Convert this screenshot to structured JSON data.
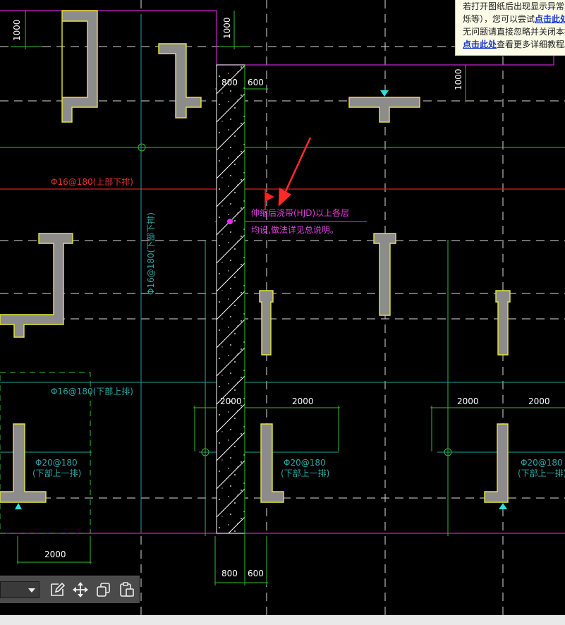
{
  "notice": {
    "line1": "若打开图纸后出现显示异常(",
    "line2_a": "烁等），您可以尝试",
    "line2_link": "点击此处",
    "line3": "无问题请直接忽略并关闭本提",
    "line4_link": "点击此处",
    "line4_b": "查看更多详细教程。"
  },
  "drawing": {
    "dim_1000_left": "1000",
    "dim_1000_top": "1000",
    "dim_1000_right": "1000",
    "dim_800_top": "800",
    "dim_600_top": "600",
    "dim_800_bottom": "800",
    "dim_600_bottom": "600",
    "rebar_red": "Φ16@180(上部下排)",
    "rebar_vertical": "Φ16@180(下部下排)",
    "rebar_cyan_mid": "Φ16@180(下部上排)",
    "rebar_left_1": "Φ20@180",
    "rebar_left_2": "(下部上一排)",
    "rebar_center_1": "Φ20@180",
    "rebar_center_2": "(下部上一排)",
    "rebar_right_1": "Φ20@180",
    "rebar_right_2": "(下部上一排)",
    "note_line1": "伸缩后浇带(HJD)以上各层",
    "note_line2": "均设,做法详见总说明。",
    "dim_2000_a": "2000",
    "dim_2000_b": "2000",
    "dim_2000_c": "2000",
    "dim_2000_d": "2000",
    "dim_2000_bottom": "2000"
  },
  "toolbar": {
    "icons": [
      "edit-icon",
      "move-icon",
      "copy-icon",
      "paste-icon"
    ]
  },
  "colors": {
    "background": "#000000",
    "column_fill": "#8a8a8a",
    "column_outline": "#e6e632",
    "axis_line": "#ffffff",
    "green_line": "#2fc82f",
    "red_line": "#e02020",
    "magenta_line": "#d020d0",
    "cyan_line": "#28a0a0"
  }
}
